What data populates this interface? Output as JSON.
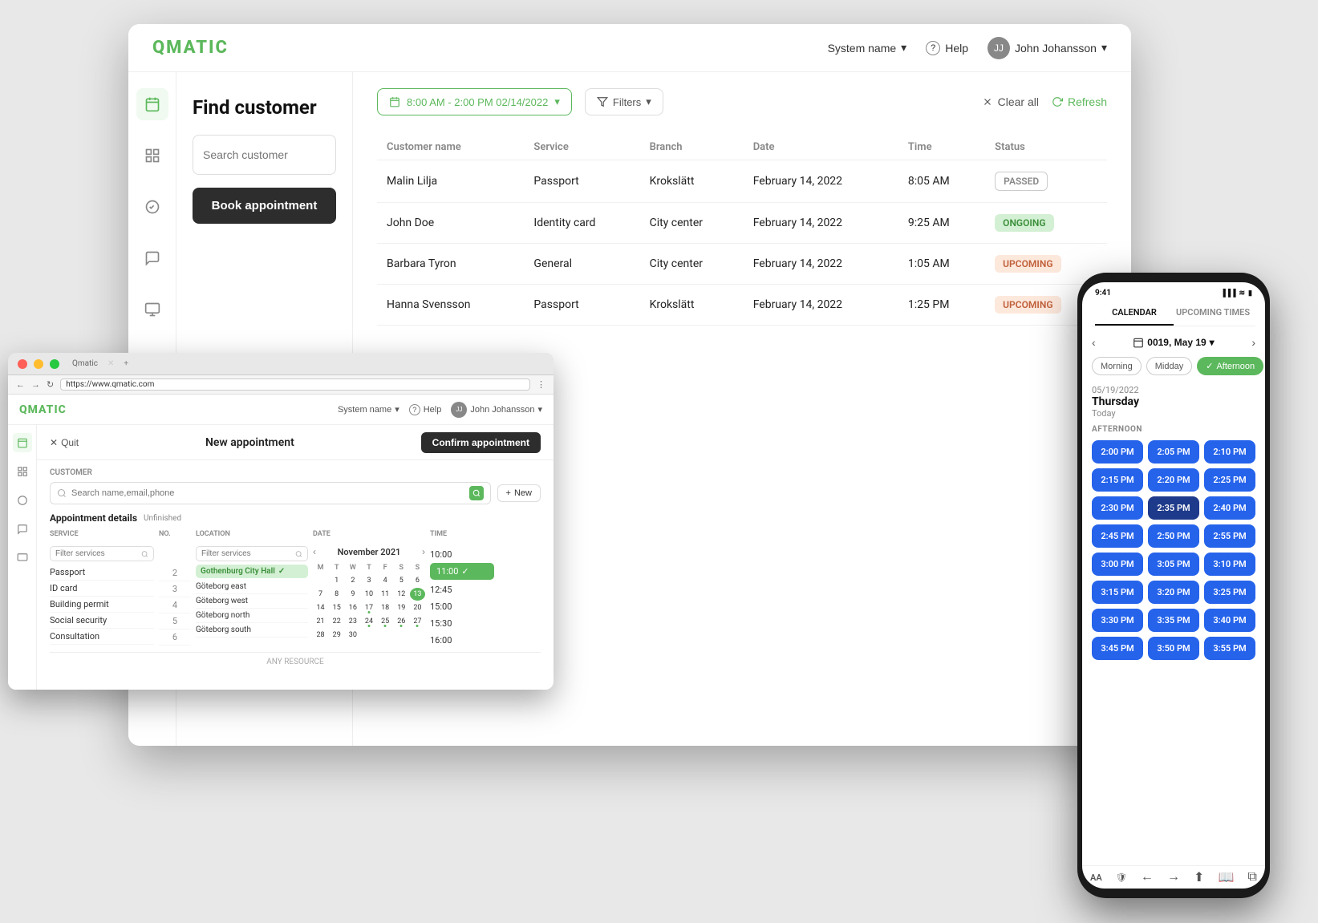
{
  "app": {
    "logo": "QMATIC",
    "system_name": "System name",
    "help": "Help",
    "user": "John Johansson"
  },
  "sidebar": {
    "items": [
      {
        "id": "calendar",
        "icon": "calendar",
        "active": true
      },
      {
        "id": "chart",
        "icon": "chart"
      },
      {
        "id": "service",
        "icon": "service"
      },
      {
        "id": "feedback",
        "icon": "feedback"
      },
      {
        "id": "display",
        "icon": "display"
      }
    ]
  },
  "left_panel": {
    "title": "Find customer",
    "search_placeholder": "Search customer",
    "book_btn": "Book appointment"
  },
  "toolbar": {
    "date_range": "8:00 AM - 2:00 PM 02/14/2022",
    "filters_label": "Filters",
    "clear_all": "Clear all",
    "refresh": "Refresh"
  },
  "table": {
    "headers": [
      "Customer name",
      "Service",
      "Branch",
      "Date",
      "Time",
      "Status"
    ],
    "rows": [
      {
        "name": "Malin Lilja",
        "service": "Passport",
        "branch": "Krokslätt",
        "date": "February 14, 2022",
        "time": "8:05 AM",
        "status": "PASSED",
        "status_type": "passed"
      },
      {
        "name": "John Doe",
        "service": "Identity card",
        "branch": "City center",
        "date": "February 14, 2022",
        "time": "9:25 AM",
        "status": "ONGOING",
        "status_type": "ongoing"
      },
      {
        "name": "Barbara Tyron",
        "service": "General",
        "branch": "City center",
        "date": "February 14, 2022",
        "time": "1:05 AM",
        "status": "UPCOMING",
        "status_type": "upcoming"
      },
      {
        "name": "Hanna Svensson",
        "service": "Passport",
        "branch": "Krokslätt",
        "date": "February 14, 2022",
        "time": "1:25 PM",
        "status": "UPCOMING",
        "status_type": "upcoming"
      }
    ]
  },
  "laptop": {
    "logo": "QMATIC",
    "system_name": "System name",
    "help": "Help",
    "user": "John Johansson",
    "url": "https://www.qmatic.com",
    "appt_header": {
      "quit": "Quit",
      "title": "New appointment",
      "confirm": "Confirm appointment"
    },
    "customer_section": {
      "label": "CUSTOMER",
      "search_placeholder": "Search name,email,phone",
      "new_btn": "New"
    },
    "appt_details": {
      "title": "Appointment details",
      "unfinished": "Unfinished"
    },
    "grid_headers": {
      "service": "SERVICE",
      "no": "NO.",
      "location": "LOCATION",
      "date": "DATE",
      "time": "TIME"
    },
    "services": [
      {
        "name": "Passport",
        "no": 2
      },
      {
        "name": "ID card",
        "no": 3
      },
      {
        "name": "Building permit",
        "no": 4
      },
      {
        "name": "Social security",
        "no": 5
      },
      {
        "name": "Consultation",
        "no": 6
      }
    ],
    "locations": [
      {
        "name": "Gothenburg City Hall",
        "selected": true
      },
      {
        "name": "Göteborg east"
      },
      {
        "name": "Göteborg west"
      },
      {
        "name": "Göteborg north"
      },
      {
        "name": "Göteborg south"
      }
    ],
    "calendar": {
      "month": "November 2021",
      "days_header": [
        "M",
        "T",
        "W",
        "T",
        "F",
        "S",
        "S"
      ],
      "selected_day": 13,
      "today": 13
    },
    "time_slots": [
      {
        "time": "10:00",
        "selected": false
      },
      {
        "time": "11:00",
        "selected": true
      },
      {
        "time": "12:45",
        "selected": false
      },
      {
        "time": "15:00",
        "selected": false
      },
      {
        "time": "15:30",
        "selected": false
      },
      {
        "time": "16:00",
        "selected": false
      }
    ],
    "any_resource": "ANY RESOURCE"
  },
  "phone": {
    "status_bar": {
      "time": "9:41",
      "signal": "●●●",
      "wifi": "wifi",
      "battery": "battery"
    },
    "tabs": [
      {
        "label": "CALENDAR",
        "active": true
      },
      {
        "label": "UPCOMING TIMES",
        "active": false
      }
    ],
    "cal_nav": {
      "month": "0019, May 19"
    },
    "time_filters": [
      {
        "label": "Morning",
        "active": false
      },
      {
        "label": "Midday",
        "active": false
      },
      {
        "label": "Afternoon",
        "active": true
      }
    ],
    "date_info": {
      "date_str": "05/19/2022",
      "day": "Thursday",
      "today_label": "Today"
    },
    "section_label": "AFTERNOON",
    "time_slots": [
      "2:00 PM",
      "2:05 PM",
      "2:10 PM",
      "2:15 PM",
      "2:20 PM",
      "2:25 PM",
      "2:30 PM",
      "2:35 PM",
      "2:40 PM",
      "2:45 PM",
      "2:50 PM",
      "2:55 PM",
      "3:00 PM",
      "3:05 PM",
      "3:10 PM",
      "3:15 PM",
      "3:20 PM",
      "3:25 PM",
      "3:30 PM",
      "3:35 PM",
      "3:40 PM",
      "3:45 PM",
      "3:50 PM",
      "3:55 PM"
    ]
  }
}
